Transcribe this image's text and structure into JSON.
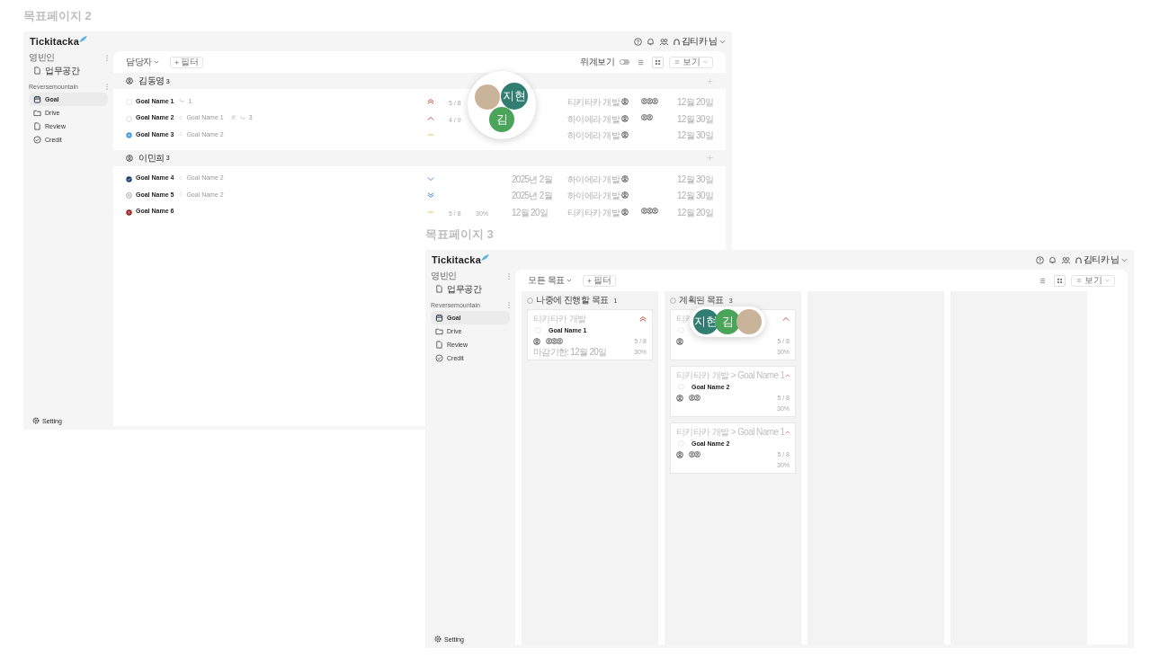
{
  "frames": [
    {
      "label": "목표페이지 2",
      "kind": "list",
      "logo": "Tickitacka",
      "user": "김티카 님",
      "sidebar": [
        {
          "title": "영빈인",
          "items": [
            {
              "label": "업무공간",
              "kind": "document",
              "selected": false
            }
          ]
        },
        {
          "title": "Reversemountain",
          "items": [
            {
              "label": "Goal",
              "kind": "calendar",
              "selected": true
            },
            {
              "label": "Drive",
              "kind": "folder",
              "selected": false
            },
            {
              "label": "Review",
              "kind": "document",
              "selected": false
            },
            {
              "label": "Credit",
              "kind": "check",
              "selected": false
            }
          ]
        }
      ],
      "setting": "Setting",
      "toolbar": {
        "dropdown": "담당자",
        "filter": "필터",
        "hierarchy": {
          "label": "위계보기",
          "on": false
        },
        "view_modes": [
          {
            "kind": "list",
            "selected": false
          },
          {
            "kind": "board",
            "selected": true
          }
        ],
        "display": "보기"
      },
      "groups": [
        {
          "title": "김동영",
          "count": "3",
          "rows": [
            {
              "status": {
                "kind": "not_started"
              },
              "name": "Goal Name 1",
              "subtasks": "1",
              "priority": {
                "kind": "highest"
              },
              "progress": "5 / 8",
              "project": "티키타카 개발",
              "members": [
                {
                  "kind": "person"
                },
                {
                  "kind": "person"
                },
                {
                  "kind": "person"
                }
              ],
              "due": "12월 20일"
            },
            {
              "status": {
                "kind": "planned"
              },
              "name": "Goal Name 2",
              "parent": "Goal Name 1",
              "description": true,
              "subtasks": "3",
              "priority": {
                "kind": "high"
              },
              "progress": "4 / 9",
              "project": "하이에라 개발",
              "members": [
                {
                  "kind": "person"
                },
                {
                  "kind": "person"
                }
              ],
              "due": "12월 30일"
            },
            {
              "status": {
                "kind": "in_progress"
              },
              "name": "Goal Name 3",
              "parent": "Goal Name 2",
              "priority": {
                "kind": "medium"
              },
              "project": "하이에라 개발",
              "due": "12월 30일"
            }
          ]
        },
        {
          "title": "이민희",
          "count": "3",
          "rows": [
            {
              "status": {
                "kind": "done"
              },
              "name": "Goal Name 4",
              "parent": "Goal Name 2",
              "priority": {
                "kind": "low"
              },
              "period": "2025년 2월",
              "project": "하이에라 개발",
              "due": "12월 30일"
            },
            {
              "status": {
                "kind": "paused"
              },
              "name": "Goal Name 5",
              "parent": "Goal Name 2",
              "priority": {
                "kind": "lowest"
              },
              "period": "2025년 2월",
              "project": "하이에라 개발",
              "due": "12월 30일"
            },
            {
              "status": {
                "kind": "cancelled"
              },
              "name": "Goal Name 6",
              "priority": {
                "kind": "medium"
              },
              "progress": "5 / 8",
              "percent": "30%",
              "period": "12월 20일",
              "project": "티키타카 개발",
              "members": [
                {
                  "kind": "person"
                },
                {
                  "kind": "person"
                },
                {
                  "kind": "person"
                }
              ],
              "due": "12월 20일"
            }
          ]
        }
      ],
      "avatar_popup": {
        "kind": "round",
        "avatars": [
          {
            "kind": "photo"
          },
          {
            "kind": "initials",
            "text": "지현",
            "color": "#317d72"
          },
          {
            "kind": "initials",
            "text": "김",
            "color": "#4aa45a"
          }
        ]
      }
    },
    {
      "label": "목표페이지 3",
      "kind": "board",
      "logo": "Tickitacka",
      "user": "김티카 님",
      "sidebar": [
        {
          "title": "영빈인",
          "items": [
            {
              "label": "업무공간",
              "kind": "document",
              "selected": false
            }
          ]
        },
        {
          "title": "Reversemountain",
          "items": [
            {
              "label": "Goal",
              "kind": "calendar",
              "selected": true
            },
            {
              "label": "Drive",
              "kind": "folder",
              "selected": false
            },
            {
              "label": "Review",
              "kind": "document",
              "selected": false
            },
            {
              "label": "Credit",
              "kind": "check",
              "selected": false
            }
          ]
        }
      ],
      "setting": "Setting",
      "toolbar": {
        "dropdown": "모든 목표",
        "filter": "필터",
        "view_modes": [
          {
            "kind": "list",
            "selected": false
          },
          {
            "kind": "board",
            "selected": true
          }
        ],
        "display": "보기"
      },
      "columns": [
        {
          "kind": "status",
          "title": "나중에 진행할 목표",
          "count": "1",
          "cards": [
            {
              "path": "티키타카 개발",
              "name": "Goal Name 1",
              "priority": {
                "kind": "highest"
              },
              "members": [
                {
                  "kind": "person"
                },
                {
                  "kind": "person"
                },
                {
                  "kind": "person"
                }
              ],
              "progress": "5 / 8",
              "due": "마감기한: 12월 20일",
              "percent": "30%"
            }
          ]
        },
        {
          "kind": "status",
          "title": "계획된 목표",
          "count": "3",
          "cards": [
            {
              "path": "티키",
              "priority": {
                "kind": "high"
              },
              "progress": "5 / 8",
              "percent": "30%"
            },
            {
              "path": "티키타카 개발 > Goal Name 1",
              "name": "Goal Name 2",
              "priority": {
                "kind": "high"
              },
              "members": [
                {
                  "kind": "person"
                },
                {
                  "kind": "person"
                }
              ],
              "progress": "5 / 8",
              "percent": "30%"
            },
            {
              "path": "티키타카 개발 > Goal Name 1",
              "name": "Goal Name 2",
              "priority": {
                "kind": "high"
              },
              "members": [
                {
                  "kind": "person"
                },
                {
                  "kind": "person"
                }
              ],
              "progress": "5 / 8",
              "percent": "30%"
            }
          ]
        },
        {
          "kind": "empty"
        },
        {
          "kind": "empty"
        }
      ],
      "avatar_popup": {
        "kind": "pill",
        "avatars": [
          {
            "kind": "initials",
            "text": "지현",
            "color": "#317d72"
          },
          {
            "kind": "initials",
            "text": "김",
            "color": "#4aa45a"
          },
          {
            "kind": "photo"
          }
        ]
      }
    }
  ]
}
